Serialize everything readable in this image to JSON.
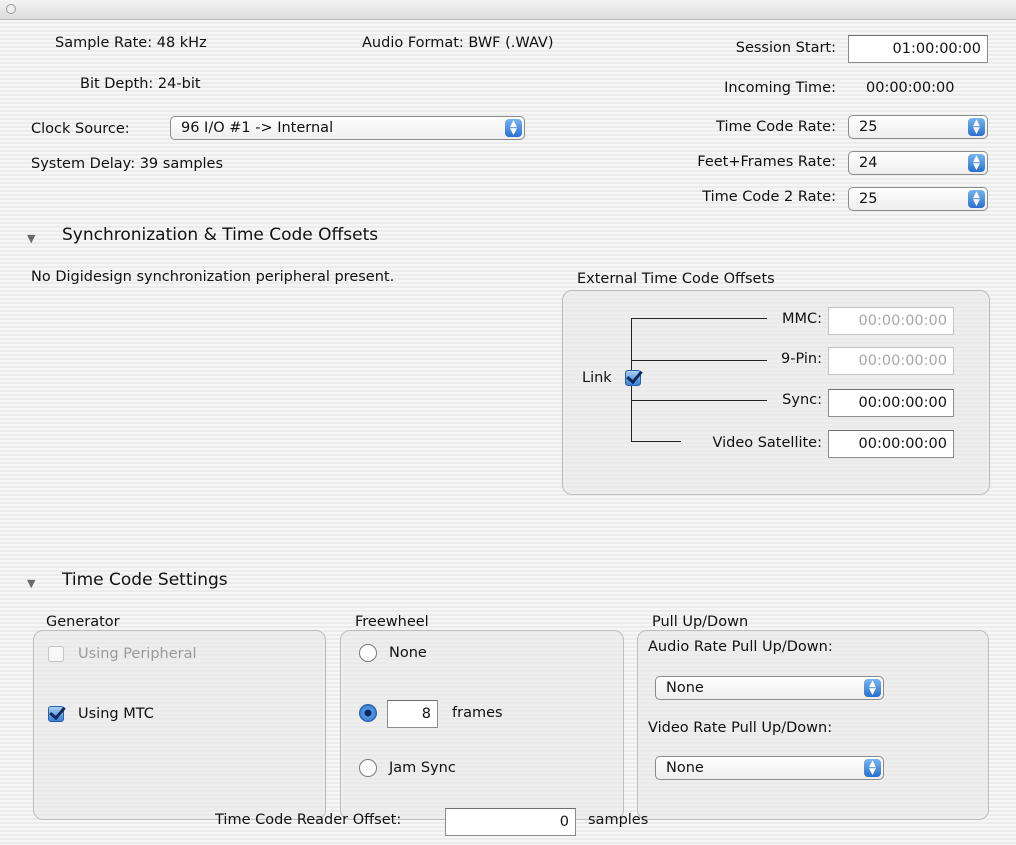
{
  "session": {
    "sample_rate": "Sample Rate: 48 kHz",
    "audio_format": "Audio Format: BWF (.WAV)",
    "bit_depth": "Bit Depth: 24-bit",
    "clock_source_label": "Clock Source:",
    "clock_source_value": "96 I/O #1 -> Internal",
    "system_delay": "System Delay: 39 samples",
    "session_start_label": "Session Start:",
    "session_start_value": "01:00:00:00",
    "incoming_time_label": "Incoming Time:",
    "incoming_time_value": "00:00:00:00",
    "time_code_rate_label": "Time Code Rate:",
    "time_code_rate_value": "25",
    "feet_frames_rate_label": "Feet+Frames Rate:",
    "feet_frames_rate_value": "24",
    "time_code_2_rate_label": "Time Code 2 Rate:",
    "time_code_2_rate_value": "25"
  },
  "sync_section": {
    "title": "Synchronization & Time Code Offsets",
    "no_peripheral": "No Digidesign synchronization peripheral present.",
    "offsets_title": "External Time Code Offsets",
    "link_label": "Link",
    "mmc_label": "MMC:",
    "mmc_value": "00:00:00:00",
    "ninepin_label": "9-Pin:",
    "ninepin_value": "00:00:00:00",
    "sync_label": "Sync:",
    "sync_value": "00:00:00:00",
    "video_sat_label": "Video Satellite:",
    "video_sat_value": "00:00:00:00"
  },
  "tc_section": {
    "title": "Time Code Settings",
    "generator_title": "Generator",
    "using_peripheral": "Using Peripheral",
    "using_mtc": "Using MTC",
    "freewheel_title": "Freewheel",
    "none_label": "None",
    "frames_value": "8",
    "frames_label": "frames",
    "jam_sync_label": "Jam Sync",
    "pull_title": "Pull Up/Down",
    "audio_pull_label": "Audio Rate Pull Up/Down:",
    "audio_pull_value": "None",
    "video_pull_label": "Video Rate Pull Up/Down:",
    "video_pull_value": "None",
    "reader_offset_label": "Time Code Reader Offset:",
    "reader_offset_value": "0",
    "reader_offset_unit": "samples"
  }
}
